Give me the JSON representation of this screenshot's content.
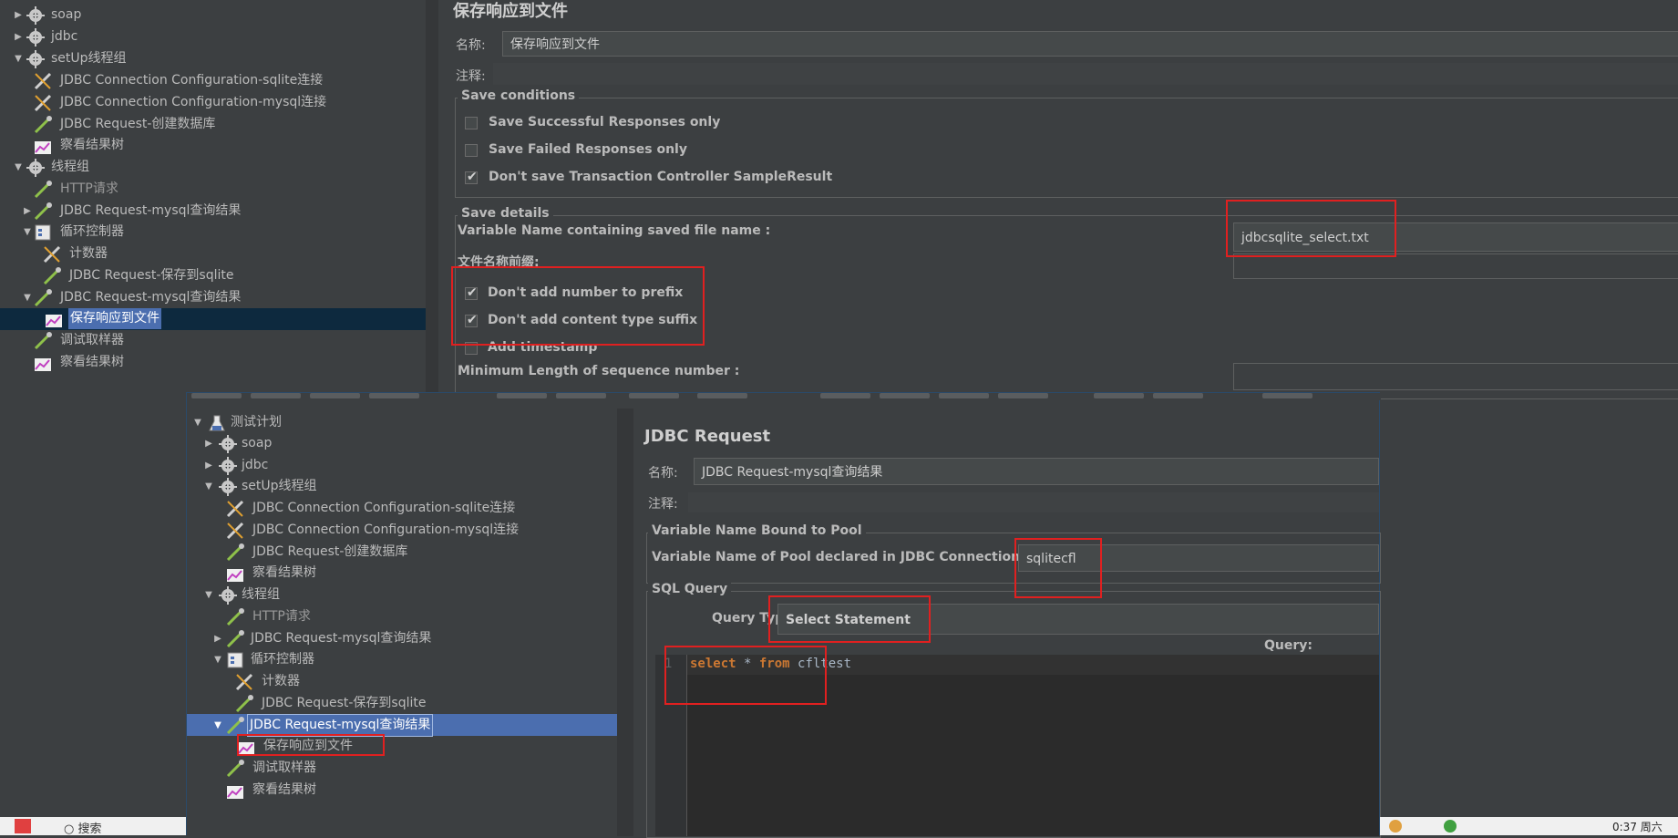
{
  "back_window": {
    "tree": [
      {
        "label": "soap",
        "icon": "gear-icon",
        "toggle": "collapsed"
      },
      {
        "label": "jdbc",
        "icon": "gear-icon",
        "toggle": "collapsed"
      },
      {
        "label": "setUp线程组",
        "icon": "gear-icon",
        "toggle": "expanded"
      },
      {
        "label": "JDBC Connection Configuration-sqlite连接",
        "icon": "wrench-icon"
      },
      {
        "label": "JDBC Connection Configuration-mysql连接",
        "icon": "wrench-icon"
      },
      {
        "label": "JDBC Request-创建数据库",
        "icon": "pipette-icon"
      },
      {
        "label": "察看结果树",
        "icon": "chart-icon"
      },
      {
        "label": "线程组",
        "icon": "gear-icon",
        "toggle": "expanded"
      },
      {
        "label": "HTTP请求",
        "icon": "pipette-icon"
      },
      {
        "label": "JDBC Request-mysql查询结果",
        "icon": "pipette-icon",
        "toggle": "collapsed"
      },
      {
        "label": "循环控制器",
        "icon": "controller-icon",
        "toggle": "expanded"
      },
      {
        "label": "计数器",
        "icon": "wrench-icon"
      },
      {
        "label": "JDBC Request-保存到sqlite",
        "icon": "pipette-icon"
      },
      {
        "label": "JDBC Request-mysql查询结果",
        "icon": "pipette-icon",
        "toggle": "expanded"
      },
      {
        "label": "保存响应到文件",
        "icon": "chart-icon",
        "selected": true
      },
      {
        "label": "调试取样器",
        "icon": "pipette-icon"
      },
      {
        "label": "察看结果树",
        "icon": "chart-icon"
      }
    ],
    "panel": {
      "title": "保存响应到文件",
      "name_label": "名称:",
      "name_value": "保存响应到文件",
      "comment_label": "注释:",
      "save_conditions_title": "Save conditions",
      "save_successful": "Save Successful Responses only",
      "save_failed": "Save Failed Responses only",
      "dont_save_tc": "Don't save Transaction Controller SampleResult",
      "save_details_title": "Save details",
      "var_name_label": "Variable Name containing saved file name :",
      "var_name_value": "jdbcsqlite_select.txt",
      "prefix_label": "文件名称前缀:",
      "no_number_prefix": "Don't add number to prefix",
      "no_content_suffix": "Don't add content type suffix",
      "add_timestamp": "Add timestamp",
      "min_length_label": "Minimum Length of sequence number :"
    }
  },
  "front_window": {
    "tree": [
      {
        "label": "测试计划",
        "icon": "flask-icon",
        "toggle": "expanded"
      },
      {
        "label": "soap",
        "icon": "gear-icon",
        "toggle": "collapsed"
      },
      {
        "label": "jdbc",
        "icon": "gear-icon",
        "toggle": "collapsed"
      },
      {
        "label": "setUp线程组",
        "icon": "gear-icon",
        "toggle": "expanded"
      },
      {
        "label": "JDBC Connection Configuration-sqlite连接",
        "icon": "wrench-icon"
      },
      {
        "label": "JDBC Connection Configuration-mysql连接",
        "icon": "wrench-icon"
      },
      {
        "label": "JDBC Request-创建数据库",
        "icon": "pipette-icon"
      },
      {
        "label": "察看结果树",
        "icon": "chart-icon"
      },
      {
        "label": "线程组",
        "icon": "gear-icon",
        "toggle": "expanded"
      },
      {
        "label": "HTTP请求",
        "icon": "pipette-icon"
      },
      {
        "label": "JDBC Request-mysql查询结果",
        "icon": "pipette-icon",
        "toggle": "collapsed"
      },
      {
        "label": "循环控制器",
        "icon": "controller-icon",
        "toggle": "expanded"
      },
      {
        "label": "计数器",
        "icon": "wrench-icon"
      },
      {
        "label": "JDBC Request-保存到sqlite",
        "icon": "pipette-icon"
      },
      {
        "label": "JDBC Request-mysql查询结果",
        "icon": "pipette-icon",
        "toggle": "expanded",
        "selected": true
      },
      {
        "label": "保存响应到文件",
        "icon": "chart-icon"
      },
      {
        "label": "调试取样器",
        "icon": "pipette-icon"
      },
      {
        "label": "察看结果树",
        "icon": "chart-icon"
      }
    ],
    "panel": {
      "title": "JDBC Request",
      "name_label": "名称:",
      "name_value": "JDBC Request-mysql查询结果",
      "comment_label": "注释:",
      "pool_group_title": "Variable Name Bound to Pool",
      "pool_label": "Variable Name of Pool declared in JDBC Connection Configuration:",
      "pool_value": "sqlitecfl",
      "sql_group_title": "SQL Query",
      "query_type_label": "Query Type",
      "query_type_value": "Select Statement",
      "query_label": "Query:",
      "line_number": "1",
      "sql_keyword1": "select",
      "sql_mid": " * ",
      "sql_keyword2": "from",
      "sql_rest": " cfltest"
    }
  },
  "taskbar": {
    "search_text": "搜索",
    "clock": "0:37 周六"
  },
  "colors": {
    "background": "#3c3f41",
    "selection": "#4b6eaf",
    "highlight_box": "#e02020",
    "sql_keyword": "#cc7832"
  }
}
